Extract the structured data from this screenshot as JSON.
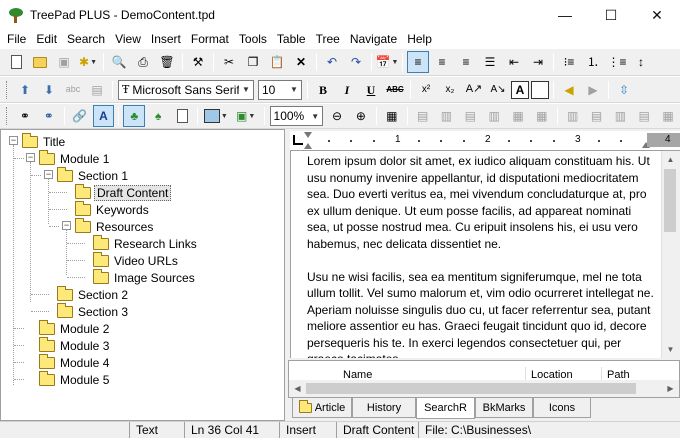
{
  "window": {
    "title": "TreePad PLUS - DemoContent.tpd",
    "minimize": "—",
    "maximize": "☐",
    "close": "✕"
  },
  "menu": [
    "File",
    "Edit",
    "Search",
    "View",
    "Insert",
    "Format",
    "Tools",
    "Table",
    "Tree",
    "Navigate",
    "Help"
  ],
  "toolbar": {
    "font_name": "Microsoft Sans Serif",
    "font_size": "10",
    "zoom": "100%",
    "bold": "B",
    "italic": "I",
    "underline": "U",
    "strike": "ABC",
    "superscript": "x²",
    "subscript": "x₂",
    "char_box": "A"
  },
  "tree": {
    "root": "Title",
    "module1": "Module 1",
    "section1": "Section 1",
    "draft_content": "Draft Content",
    "keywords": "Keywords",
    "resources": "Resources",
    "research_links": "Research Links",
    "video_urls": "Video URLs",
    "image_sources": "Image Sources",
    "section2": "Section 2",
    "section3": "Section 3",
    "module2": "Module 2",
    "module3": "Module 3",
    "module4": "Module 4",
    "module5": "Module 5"
  },
  "ruler": {
    "n1": "1",
    "n2": "2",
    "n3": "3",
    "n4": "4"
  },
  "editor": {
    "paragraph1": "Lorem ipsum dolor sit amet, ex iudico aliquam constituam his. Ut usu nonumy invenire appellantur, id disputationi mediocritatem sea. Duo everti veritus ea, mei vivendum concludaturque at, pro ex ullum denique. Ut eum posse facilis, ad appareat nominati sea, ut posse nostrud mea. Cu eripuit insolens his, ei usu vero habemus, nec delicata dissentiet ne.",
    "paragraph2": "Usu ne wisi facilis, sea ea mentitum signiferumque, mel ne tota ullum tollit. Vel sumo malorum et, vim odio ocurreret intellegat ne. Aperiam noluisse singulis duo cu, ut facer referrentur sea, putant meliore assentior eu has. Graeci feugait tincidunt quo id, decore persequeris his te. In exerci legendos consectetuer qui, per graeco tacimates."
  },
  "results_columns": {
    "name": "Name",
    "location": "Location",
    "path": "Path"
  },
  "tabs": {
    "article": "Article",
    "history": "History",
    "search": "SearchR",
    "bookmarks": "BkMarks",
    "icons": "Icons"
  },
  "status": {
    "mode": "Text",
    "position": "Ln 36  Col 41",
    "insert": "Insert",
    "node": "Draft Content",
    "file": "File: C:\\Businesses\\"
  }
}
